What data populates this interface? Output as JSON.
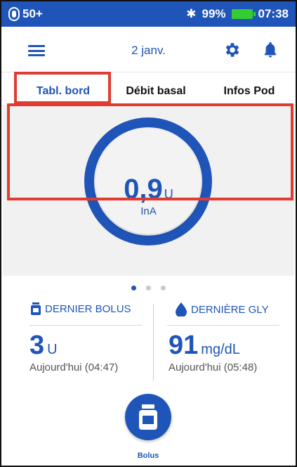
{
  "status_bar": {
    "pod_reading": "50+",
    "battery": "99%",
    "time": "07:38"
  },
  "header": {
    "date": "2 janv."
  },
  "tabs": [
    {
      "label": "Tabl. bord"
    },
    {
      "label": "Débit basal"
    },
    {
      "label": "Infos Pod"
    }
  ],
  "iob": {
    "value": "0,9",
    "unit": "U",
    "label": "InA"
  },
  "last_bolus": {
    "title": "DERNIER BOLUS",
    "value": "3",
    "unit": "U",
    "time": "Aujourd'hui (04:47)"
  },
  "last_gly": {
    "title": "DERNIÈRE GLY",
    "value": "91",
    "unit": "mg/dL",
    "time": "Aujourd'hui (05:48)"
  },
  "bolus_button": {
    "label": "Bolus"
  },
  "colors": {
    "primary": "#1f55b8",
    "highlight": "#e03c31",
    "battery": "#33cc33"
  }
}
